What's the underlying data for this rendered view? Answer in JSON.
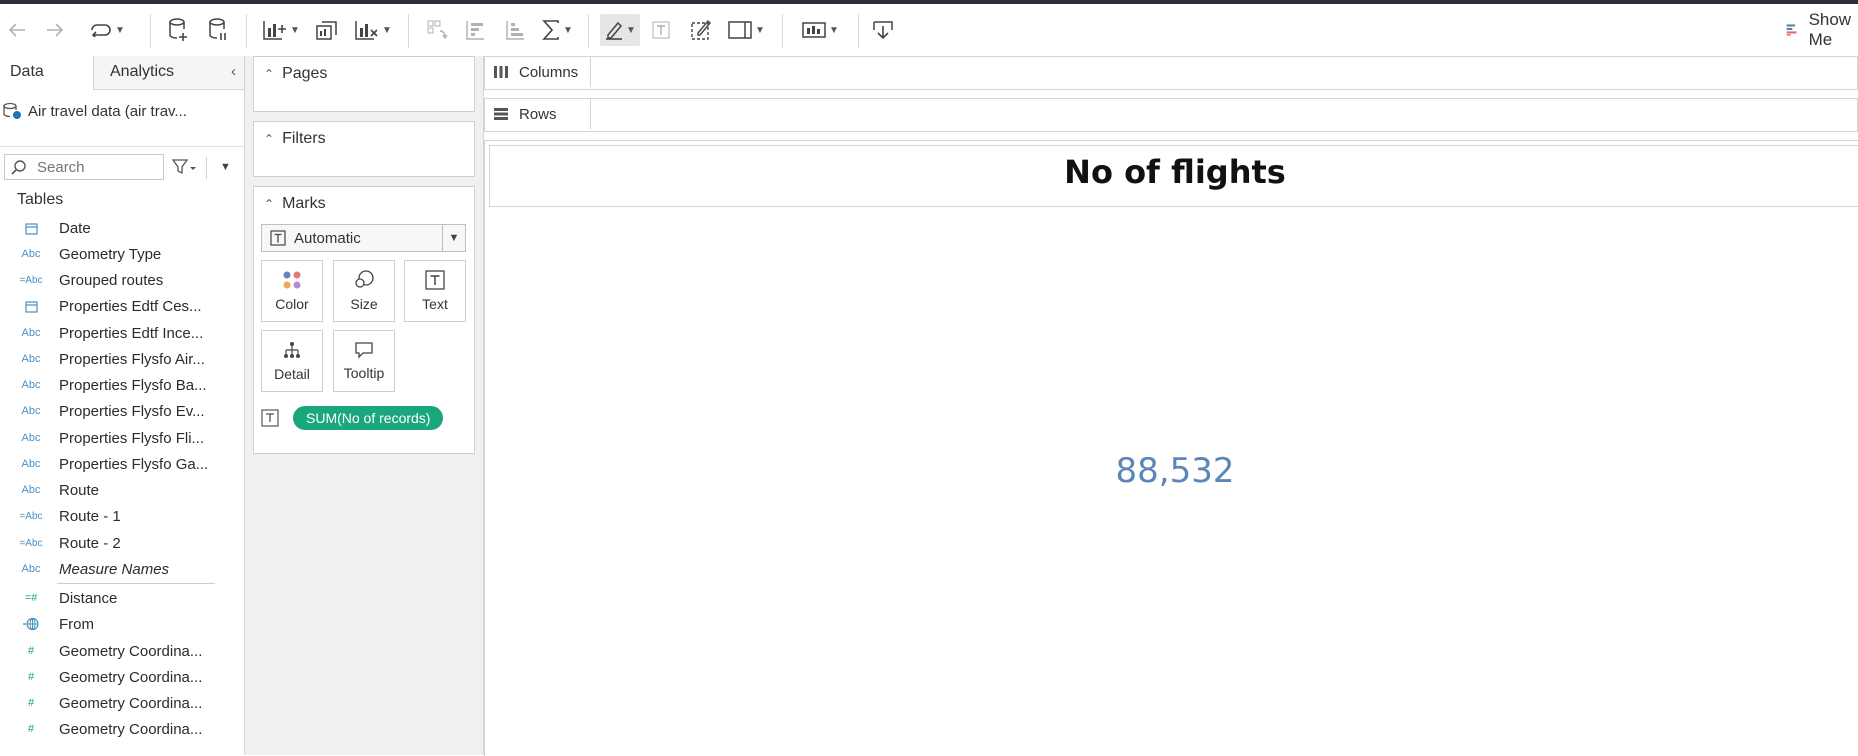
{
  "toolbar": {
    "show_me_label": "Show Me"
  },
  "data_pane": {
    "tabs": [
      "Data",
      "Analytics"
    ],
    "datasource_name": "Air travel data (air trav...",
    "search_placeholder": "Search",
    "tables_header": "Tables",
    "fields": [
      {
        "icon": "calendar",
        "name": "Date"
      },
      {
        "icon": "Abc",
        "name": "Geometry Type"
      },
      {
        "icon": "=Abc",
        "name": "Grouped routes"
      },
      {
        "icon": "calendar",
        "name": "Properties Edtf Ces..."
      },
      {
        "icon": "Abc",
        "name": "Properties Edtf Ince..."
      },
      {
        "icon": "Abc",
        "name": "Properties Flysfo Air..."
      },
      {
        "icon": "Abc",
        "name": "Properties Flysfo Ba..."
      },
      {
        "icon": "Abc",
        "name": "Properties Flysfo Ev..."
      },
      {
        "icon": "Abc",
        "name": "Properties Flysfo Fli..."
      },
      {
        "icon": "Abc",
        "name": "Properties Flysfo Ga..."
      },
      {
        "icon": "Abc",
        "name": "Route"
      },
      {
        "icon": "=Abc",
        "name": "Route - 1"
      },
      {
        "icon": "=Abc",
        "name": "Route - 2"
      },
      {
        "icon": "Abc",
        "name": "Measure Names"
      },
      {
        "icon": "=#",
        "name": "Distance"
      },
      {
        "icon": "=globe",
        "name": "From"
      },
      {
        "icon": "#",
        "name": "Geometry Coordina..."
      },
      {
        "icon": "#",
        "name": "Geometry Coordina..."
      },
      {
        "icon": "#",
        "name": "Geometry Coordina..."
      },
      {
        "icon": "#",
        "name": "Geometry Coordina..."
      }
    ]
  },
  "cards": {
    "pages_label": "Pages",
    "filters_label": "Filters",
    "marks_label": "Marks",
    "mark_type": "Automatic",
    "mark_buttons": [
      "Color",
      "Size",
      "Text",
      "Detail",
      "Tooltip"
    ],
    "text_pill": "SUM(No of records)"
  },
  "shelves": {
    "columns_label": "Columns",
    "rows_label": "Rows"
  },
  "view": {
    "title": "No of flights",
    "value": "88,532"
  }
}
